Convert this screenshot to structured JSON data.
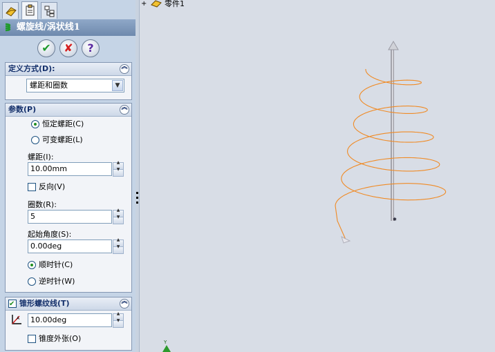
{
  "property_manager": {
    "title": "螺旋线/涡状线1",
    "tabs": [
      "feature-manager",
      "property-manager",
      "configuration-manager"
    ],
    "buttons": {
      "ok": "✔",
      "cancel": "✘",
      "help": "?"
    },
    "groups": {
      "definition": {
        "header": "定义方式(D):",
        "selected": "螺距和圈数",
        "collapse_glyph": "︽"
      },
      "parameters": {
        "header": "参数(P)",
        "collapse_glyph": "︽",
        "pitch_mode_constant": "恒定螺距(C)",
        "pitch_mode_variable": "可变螺距(L)",
        "pitch_mode_selected": "constant",
        "pitch_label": "螺距(I):",
        "pitch_value": "10.00mm",
        "reverse_label": "反向(V)",
        "reverse_checked": false,
        "revolutions_label": "圈数(R):",
        "revolutions_value": "5",
        "start_angle_label": "起始角度(S):",
        "start_angle_value": "0.00deg",
        "clockwise_label": "顺时针(C)",
        "counterclockwise_label": "逆时针(W)",
        "direction_selected": "clockwise"
      },
      "taper": {
        "header": "锥形螺纹线(T)",
        "enabled": true,
        "collapse_glyph": "︽",
        "angle_value": "10.00deg",
        "taper_outward_label": "锥度外张(O)",
        "taper_outward_checked": false
      }
    }
  },
  "feature_tree": {
    "expand_glyph": "+",
    "root_label": "零件1"
  },
  "colors": {
    "helix": "#f08a24",
    "axis": "#9a9aa2",
    "panel_bg": "#c5d4e6",
    "group_header_text": "#14306b"
  }
}
